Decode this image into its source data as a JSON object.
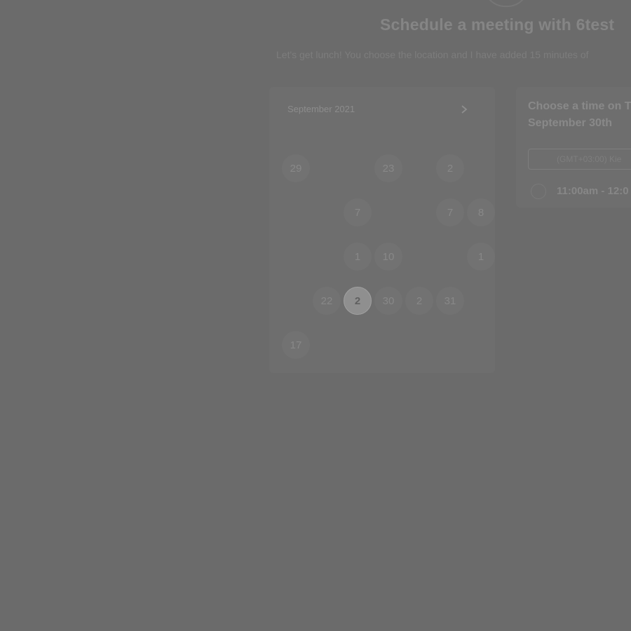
{
  "header": {
    "title": "Schedule a meeting with 6test",
    "subtitle": "Let's get lunch! You choose the location and I have added 15 minutes of"
  },
  "calendar": {
    "month_label": "September 2021",
    "next_icon": "chevron-right-icon",
    "weekdays": [
      "",
      "",
      "",
      "",
      "",
      "",
      ""
    ],
    "days": [
      {
        "label": "29",
        "state": "available"
      },
      {
        "label": "",
        "state": "empty"
      },
      {
        "label": "",
        "state": "empty"
      },
      {
        "label": "23",
        "state": "available"
      },
      {
        "label": "",
        "state": "empty"
      },
      {
        "label": "2",
        "state": "available"
      },
      {
        "label": "",
        "state": "empty"
      },
      {
        "label": "",
        "state": "empty"
      },
      {
        "label": "",
        "state": "empty"
      },
      {
        "label": "7",
        "state": "available"
      },
      {
        "label": "",
        "state": "empty"
      },
      {
        "label": "",
        "state": "empty"
      },
      {
        "label": "7",
        "state": "available"
      },
      {
        "label": "8",
        "state": "available"
      },
      {
        "label": "",
        "state": "empty"
      },
      {
        "label": "",
        "state": "empty"
      },
      {
        "label": "1",
        "state": "available"
      },
      {
        "label": "10",
        "state": "available"
      },
      {
        "label": "",
        "state": "empty"
      },
      {
        "label": "",
        "state": "empty"
      },
      {
        "label": "1",
        "state": "available"
      },
      {
        "label": "",
        "state": "empty"
      },
      {
        "label": "22",
        "state": "available"
      },
      {
        "label": "2",
        "state": "selected"
      },
      {
        "label": "30",
        "state": "available"
      },
      {
        "label": "2",
        "state": "available"
      },
      {
        "label": "31",
        "state": "available"
      },
      {
        "label": "",
        "state": "empty"
      },
      {
        "label": "17",
        "state": "available"
      },
      {
        "label": "",
        "state": "empty"
      },
      {
        "label": "",
        "state": "empty"
      },
      {
        "label": "",
        "state": "empty"
      },
      {
        "label": "",
        "state": "empty"
      },
      {
        "label": "",
        "state": "empty"
      },
      {
        "label": "",
        "state": "empty"
      }
    ]
  },
  "times": {
    "heading": "Choose a time on T",
    "heading_line2": "September 30th",
    "timezone": "(GMT+03:00) Kie",
    "slot_label": "11:00am - 12:0"
  }
}
